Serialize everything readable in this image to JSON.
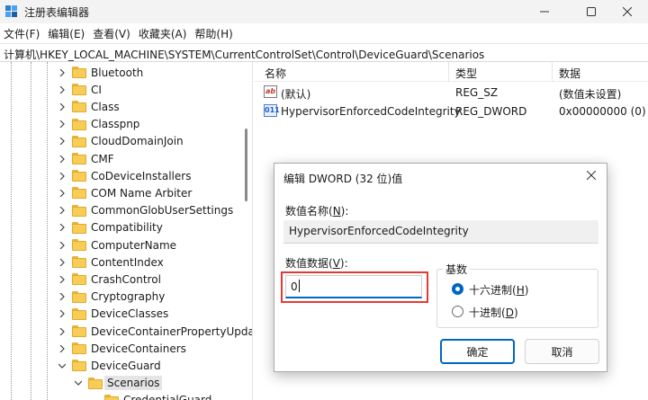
{
  "window": {
    "title": "注册表编辑器"
  },
  "menu": [
    "文件(F)",
    "编辑(E)",
    "查看(V)",
    "收藏夹(A)",
    "帮助(H)"
  ],
  "address": "计算机\\HKEY_LOCAL_MACHINE\\SYSTEM\\CurrentControlSet\\Control\\DeviceGuard\\Scenarios",
  "tree": {
    "items": [
      {
        "label": "Bluetooth"
      },
      {
        "label": "CI"
      },
      {
        "label": "Class"
      },
      {
        "label": "Classpnp"
      },
      {
        "label": "CloudDomainJoin"
      },
      {
        "label": "CMF"
      },
      {
        "label": "CoDeviceInstallers"
      },
      {
        "label": "COM Name Arbiter"
      },
      {
        "label": "CommonGlobUserSettings"
      },
      {
        "label": "Compatibility"
      },
      {
        "label": "ComputerName"
      },
      {
        "label": "ContentIndex"
      },
      {
        "label": "CrashControl"
      },
      {
        "label": "Cryptography"
      },
      {
        "label": "DeviceClasses"
      },
      {
        "label": "DeviceContainerPropertyUpda"
      },
      {
        "label": "DeviceContainers"
      },
      {
        "label": "DeviceGuard",
        "expanded": true
      },
      {
        "label": "Scenarios",
        "expanded": true,
        "selected": true
      },
      {
        "label": "CredentialGuard"
      }
    ]
  },
  "list": {
    "columns": [
      "名称",
      "类型",
      "数据"
    ],
    "rows": [
      {
        "icon": "string-value-icon",
        "name": "(默认)",
        "type": "REG_SZ",
        "data": "(数值未设置)"
      },
      {
        "icon": "dword-value-icon",
        "name": "HypervisorEnforcedCodeIntegrity",
        "type": "REG_DWORD",
        "data": "0x00000000 (0)"
      }
    ]
  },
  "dialog": {
    "title": "编辑 DWORD (32 位)值",
    "name_label_text": "数值名称(",
    "name_label_key": "N",
    "name_label_end": "):",
    "value_name": "HypervisorEnforcedCodeIntegrity",
    "data_label_text": "数值数据(",
    "data_label_key": "V",
    "data_label_end": "):",
    "value_data": "0",
    "base_title": "基数",
    "radio_hex_text": "十六进制(",
    "radio_hex_key": "H",
    "radio_hex_end": ")",
    "radio_dec_text": "十进制(",
    "radio_dec_key": "D",
    "radio_dec_end": ")",
    "selected_base": "hex",
    "ok_label": "确定",
    "cancel_label": "取消"
  },
  "colors": {
    "accent": "#0067c0",
    "highlight_border": "#e53935",
    "folder": "#f8cd55"
  }
}
